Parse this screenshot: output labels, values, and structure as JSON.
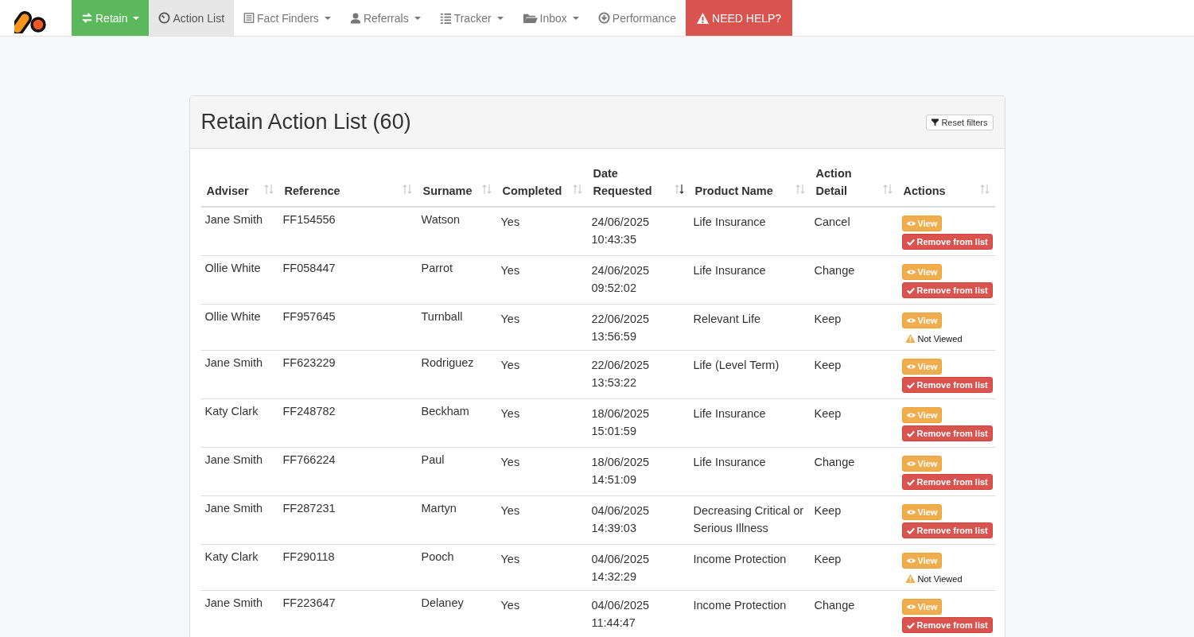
{
  "nav": {
    "items": [
      {
        "label": "Retain",
        "kind": "brand",
        "selected": false,
        "dropdown": true
      },
      {
        "label": "Action List",
        "kind": "normal",
        "selected": true,
        "dropdown": false
      },
      {
        "label": "Fact Finders",
        "kind": "normal",
        "selected": false,
        "dropdown": true
      },
      {
        "label": "Referrals",
        "kind": "normal",
        "selected": false,
        "dropdown": true
      },
      {
        "label": "Tracker",
        "kind": "normal",
        "selected": false,
        "dropdown": true
      },
      {
        "label": "Inbox",
        "kind": "normal",
        "selected": false,
        "dropdown": true
      },
      {
        "label": "Performance",
        "kind": "normal",
        "selected": false,
        "dropdown": false
      },
      {
        "label": "NEED HELP?",
        "kind": "danger",
        "selected": false,
        "dropdown": false
      }
    ]
  },
  "panel": {
    "title": "Retain Action List (60)",
    "reset_button": "Reset filters"
  },
  "table": {
    "columns": [
      {
        "label": "Adviser",
        "sorted": false
      },
      {
        "label": "Reference",
        "sorted": false
      },
      {
        "label": "Surname",
        "sorted": false
      },
      {
        "label": "Completed",
        "sorted": false
      },
      {
        "label": "Date Requested",
        "sorted": true
      },
      {
        "label": "Product Name",
        "sorted": false
      },
      {
        "label": "Action Detail",
        "sorted": false
      },
      {
        "label": "Actions",
        "sorted": false
      }
    ],
    "rows": [
      {
        "adviser": "Jane Smith",
        "reference": "FF154556",
        "surname": "Watson",
        "completed": "Yes",
        "date": "24/06/2025 10:43:35",
        "product": "Life Insurance",
        "action": "Cancel",
        "view": "View",
        "kind": "remove",
        "second": "Remove from list"
      },
      {
        "adviser": "Ollie White",
        "reference": "FF058447",
        "surname": "Parrot",
        "completed": "Yes",
        "date": "24/06/2025 09:52:02",
        "product": "Life Insurance",
        "action": "Change",
        "view": "View",
        "kind": "remove",
        "second": "Remove from list"
      },
      {
        "adviser": "Ollie White",
        "reference": "FF957645",
        "surname": "Turnball",
        "completed": "Yes",
        "date": "22/06/2025 13:56:59",
        "product": "Relevant Life",
        "action": "Keep",
        "view": "View",
        "kind": "not_viewed",
        "second": "Not Viewed"
      },
      {
        "adviser": "Jane Smith",
        "reference": "FF623229",
        "surname": "Rodriguez",
        "completed": "Yes",
        "date": "22/06/2025 13:53:22",
        "product": "Life (Level Term)",
        "action": "Keep",
        "view": "View",
        "kind": "remove",
        "second": "Remove from list"
      },
      {
        "adviser": "Katy Clark",
        "reference": "FF248782",
        "surname": "Beckham",
        "completed": "Yes",
        "date": "18/06/2025 15:01:59",
        "product": "Life Insurance",
        "action": "Keep",
        "view": "View",
        "kind": "remove",
        "second": "Remove from list"
      },
      {
        "adviser": "Jane Smith",
        "reference": "FF766224",
        "surname": "Paul",
        "completed": "Yes",
        "date": "18/06/2025 14:51:09",
        "product": "Life Insurance",
        "action": "Change",
        "view": "View",
        "kind": "remove",
        "second": "Remove from list"
      },
      {
        "adviser": "Jane Smith",
        "reference": "FF287231",
        "surname": "Martyn",
        "completed": "Yes",
        "date": "04/06/2025 14:39:03",
        "product": "Decreasing Critical or Serious Illness",
        "action": "Keep",
        "view": "View",
        "kind": "remove",
        "second": "Remove from list"
      },
      {
        "adviser": "Katy Clark",
        "reference": "FF290118",
        "surname": "Pooch",
        "completed": "Yes",
        "date": "04/06/2025 14:32:29",
        "product": "Income Protection",
        "action": "Keep",
        "view": "View",
        "kind": "not_viewed",
        "second": "Not Viewed"
      },
      {
        "adviser": "Jane Smith",
        "reference": "FF223647",
        "surname": "Delaney",
        "completed": "Yes",
        "date": "04/06/2025 11:44:47",
        "product": "Income Protection",
        "action": "Change",
        "view": "View",
        "kind": "remove",
        "second": "Remove from list"
      }
    ]
  }
}
